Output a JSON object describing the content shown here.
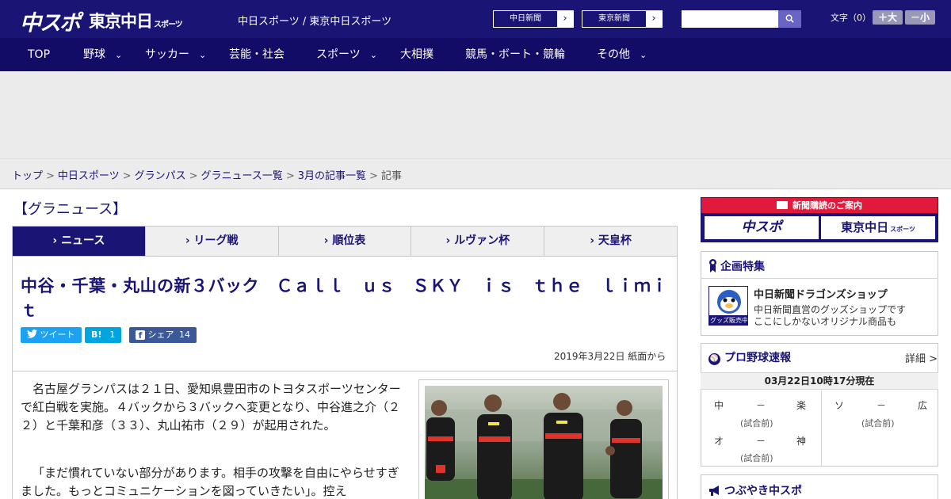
{
  "header": {
    "logo_main": "中スポ",
    "logo_tokyo": "東京中日",
    "logo_tokyo_sub": "スポーツ",
    "site_name": "中日スポーツ / 東京中日スポーツ",
    "paper_buttons": [
      {
        "label": "中日新聞",
        "arrow": "›"
      },
      {
        "label": "東京新聞",
        "arrow": "›"
      }
    ],
    "search_icon": "search-icon",
    "font_size_label": "文字（0）",
    "font_larger": "＋大",
    "font_smaller": "－小"
  },
  "nav": {
    "items": [
      {
        "label": "TOP",
        "has_dropdown": false
      },
      {
        "label": "野球",
        "has_dropdown": true
      },
      {
        "label": "サッカー",
        "has_dropdown": true
      },
      {
        "label": "芸能・社会",
        "has_dropdown": false
      },
      {
        "label": "スポーツ",
        "has_dropdown": true
      },
      {
        "label": "大相撲",
        "has_dropdown": false
      },
      {
        "label": "競馬・ボート・競輪",
        "has_dropdown": false
      },
      {
        "label": "その他",
        "has_dropdown": true
      }
    ],
    "chevron": "⌄"
  },
  "breadcrumb": {
    "items": [
      "トップ",
      "中日スポーツ",
      "グランパス",
      "グラニュース一覧",
      "3月の記事一覧",
      "記事"
    ],
    "separator": ">"
  },
  "section_title": "【グラニュース】",
  "tabs": [
    {
      "label": "ニュース",
      "active": true
    },
    {
      "label": "リーグ戦",
      "active": false
    },
    {
      "label": "順位表",
      "active": false
    },
    {
      "label": "ルヴァン杯",
      "active": false
    },
    {
      "label": "天皇杯",
      "active": false
    }
  ],
  "tab_marker": "›",
  "article": {
    "headline": "中谷・千葉・丸山の新３バック　Ｃａｌｌ　ｕｓ　ＳＫＹ　ｉｓ　ｔｈｅ　ｌｉｍｉｔ",
    "share": {
      "tweet": "ツイート",
      "hatena_label": "B!",
      "hatena_count": "1",
      "facebook_label": "シェア",
      "facebook_count": "14"
    },
    "date": "2019年3月22日 紙面から",
    "paragraphs": [
      "名古屋グランパスは２１日、愛知県豊田市のトヨタスポーツセンターで紅白戦を実施。４バックから３バックへ変更となり、中谷進之介（２２）と千葉和彦（３３）、丸山祐市（２９）が起用された。",
      "「まだ慣れていない部分があります。相手の攻撃を自由にやらせすぎました。もっとコミュニケーションを図っていきたい」。控え"
    ]
  },
  "sidebar": {
    "subscribe_title": "新聞購読のご案内",
    "subscribe_logos": [
      "中スポ",
      "東京中日"
    ],
    "subscribe_logo_sub": "スポーツ",
    "feature_title": "企画特集",
    "shop_title": "中日新聞ドラゴンズショップ",
    "shop_desc": [
      "中日新聞直営のグッズショップです",
      "ここにしかないオリジナル商品も"
    ],
    "mascot_badge": "グッズ販売中",
    "baseball_title": "プロ野球速報",
    "baseball_detail": "詳細 >",
    "baseball_time": "03月22日10時17分現在",
    "games": [
      {
        "home": "中",
        "dash": "－",
        "away": "楽",
        "status": "(試合前)"
      },
      {
        "home": "ソ",
        "dash": "－",
        "away": "広",
        "status": "(試合前)"
      },
      {
        "home": "オ",
        "dash": "－",
        "away": "神",
        "status": "(試合前)"
      }
    ],
    "tsubuyaki_title": "つぶやき中スポ"
  },
  "colors": {
    "brand_navy": "#1a1474",
    "nav_bg": "#130c66",
    "accent_red": "#e11a3c",
    "twitter": "#1da1f2",
    "hatena": "#00a4de",
    "facebook": "#3b5998"
  }
}
